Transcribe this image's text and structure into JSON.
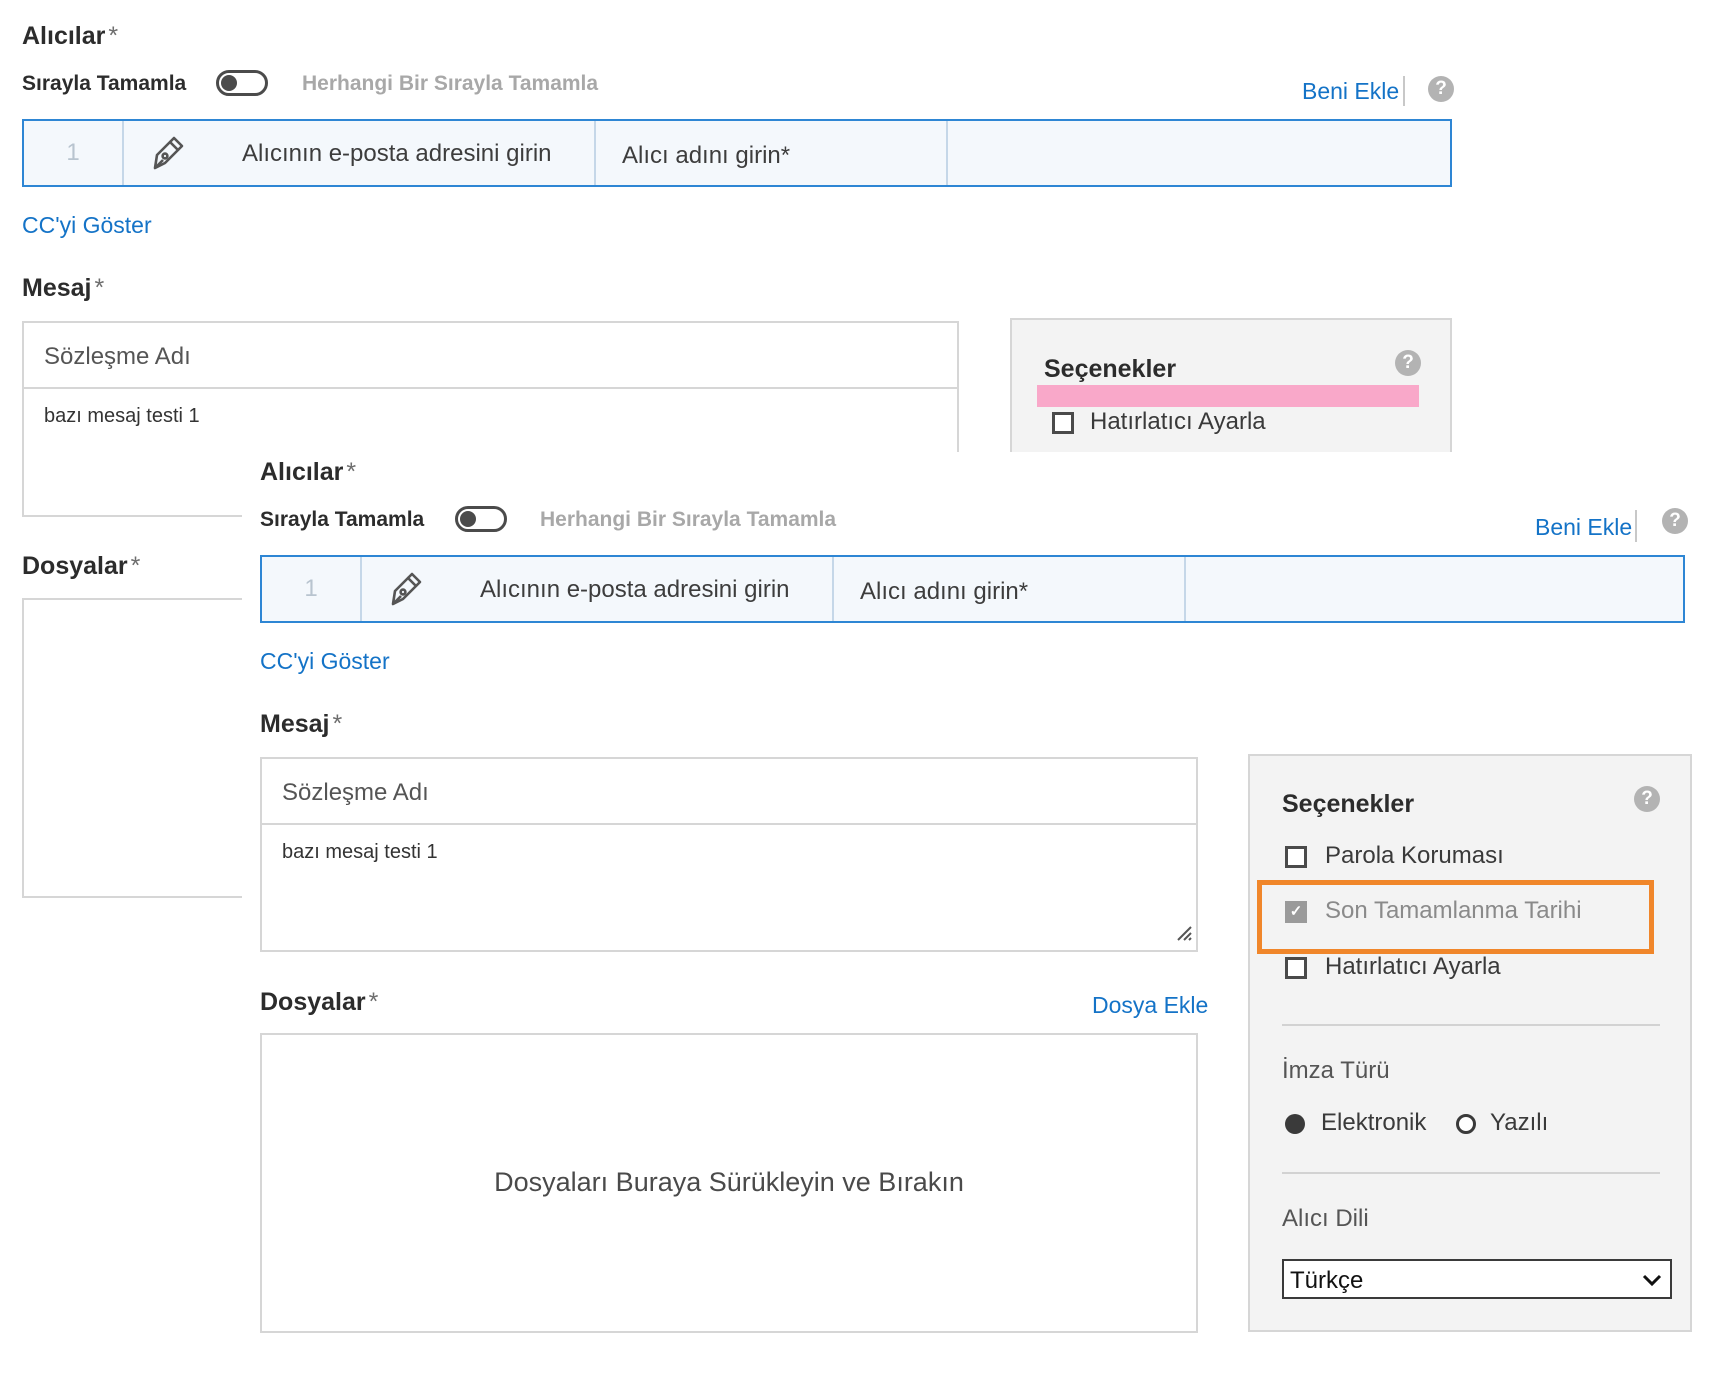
{
  "recipients": {
    "label": "Alıcılar",
    "required_mark": "*",
    "complete_in_order": "Sırayla Tamamla",
    "complete_any_order": "Herhangi Bir Sırayla Tamamla",
    "add_me": "Beni Ekle",
    "help": "?",
    "row": {
      "number": "1",
      "email_placeholder": "Alıcının e-posta adresini girin",
      "name_placeholder": "Alıcı adını girin*"
    },
    "show_cc": "CC'yi Göster"
  },
  "message": {
    "label": "Mesaj",
    "required_mark": "*",
    "agreement_name": "Sözleşme Adı",
    "body": "bazı mesaj testi 1"
  },
  "files": {
    "label": "Dosyalar",
    "required_mark": "*",
    "add_file": "Dosya Ekle",
    "drop_zone": "Dosyaları Buraya Sürükleyin ve Bırakın"
  },
  "options": {
    "title": "Seçenekler",
    "help": "?",
    "password_protection": "Parola Koruması",
    "completion_deadline": "Son Tamamlanma Tarihi",
    "set_reminder": "Hatırlatıcı Ayarla",
    "signature_type_label": "İmza Türü",
    "signature_electronic": "Elektronik",
    "signature_written": "Yazılı",
    "recipient_language_label": "Alıcı Dili",
    "recipient_language_value": "Türkçe"
  },
  "colors": {
    "link": "#1473c7",
    "recipient_border": "#2e86d4",
    "highlight_pink": "#f9a8c9",
    "highlight_orange": "#f0862a"
  },
  "icons": {
    "signer": "pen-nib-icon",
    "help": "question-circle-icon",
    "dropdown": "chevron-down-icon"
  }
}
